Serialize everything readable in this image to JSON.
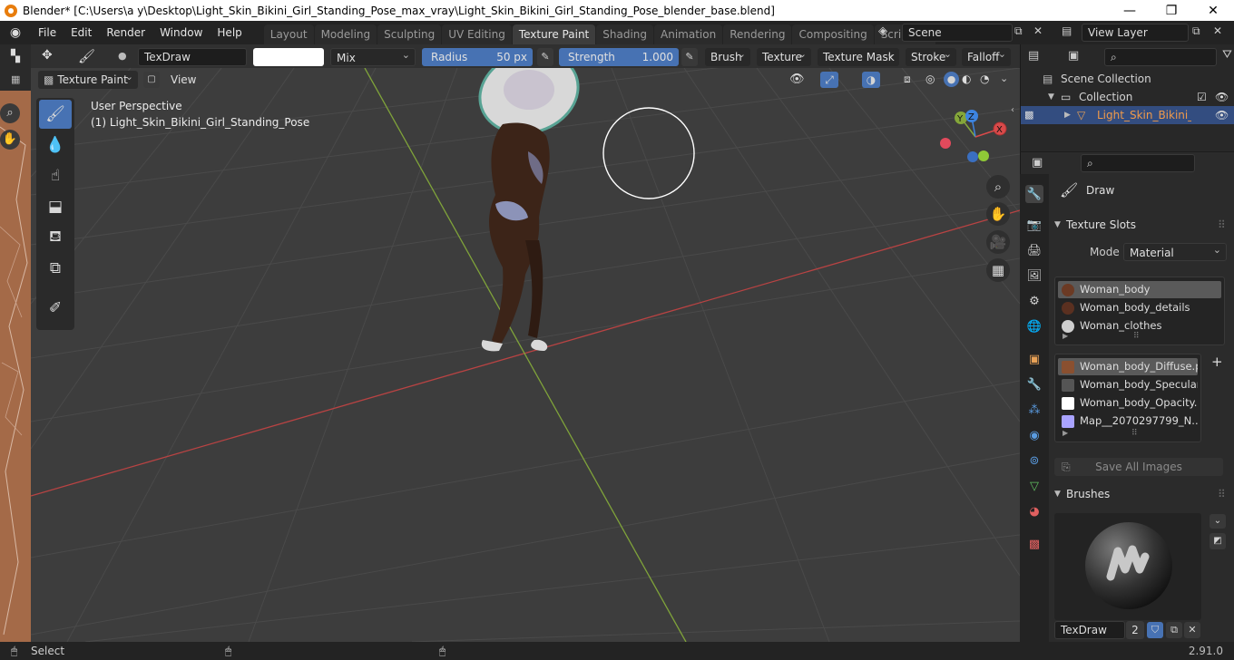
{
  "window": {
    "title": "Blender* [C:\\Users\\a y\\Desktop\\Light_Skin_Bikini_Girl_Standing_Pose_max_vray\\Light_Skin_Bikini_Girl_Standing_Pose_blender_base.blend]"
  },
  "menu": [
    "File",
    "Edit",
    "Render",
    "Window",
    "Help"
  ],
  "workspaces": [
    "Layout",
    "Modeling",
    "Sculpting",
    "UV Editing",
    "Texture Paint",
    "Shading",
    "Animation",
    "Rendering",
    "Compositing",
    "Scripting"
  ],
  "active_workspace": "Texture Paint",
  "scene": {
    "name": "Scene",
    "view_layer": "View Layer"
  },
  "tool_header": {
    "brush_name": "TexDraw",
    "blend": "Mix",
    "radius_label": "Radius",
    "radius_value": "50 px",
    "strength_label": "Strength",
    "strength_value": "1.000",
    "strength_fraction": 1.0,
    "menus": [
      "Brush",
      "Texture",
      "Texture Mask",
      "Stroke",
      "Falloff"
    ]
  },
  "mode_header": {
    "mode": "Texture Paint",
    "view": "View"
  },
  "viewport": {
    "perspective": "User Perspective",
    "object_line": "(1) Light_Skin_Bikini_Girl_Standing_Pose"
  },
  "gizmo": {
    "x": "X",
    "y": "Y",
    "z": "Z"
  },
  "outliner": {
    "scene_collection": "Scene Collection",
    "collection": "Collection",
    "object": "Light_Skin_Bikini_Girl_Standing_Pose"
  },
  "properties": {
    "tool_name": "Draw",
    "texture_slots_title": "Texture Slots",
    "mode_label": "Mode",
    "mode_value": "Material",
    "materials": [
      "Woman_body",
      "Woman_body_details",
      "Woman_clothes"
    ],
    "images": [
      "Woman_body_Diffuse.p...",
      "Woman_body_Specular...",
      "Woman_body_Opacity....",
      "Map__2070297799_N..."
    ],
    "save_all": "Save All Images",
    "brushes_title": "Brushes",
    "brush_name": "TexDraw",
    "brush_users": "2"
  },
  "status": {
    "left": "Select",
    "version": "2.91.0"
  },
  "colors": {
    "accent": "#4772b3",
    "x_axis": "#b84343",
    "y_axis": "#7fa33a",
    "z_axis": "#3a7fd9"
  }
}
